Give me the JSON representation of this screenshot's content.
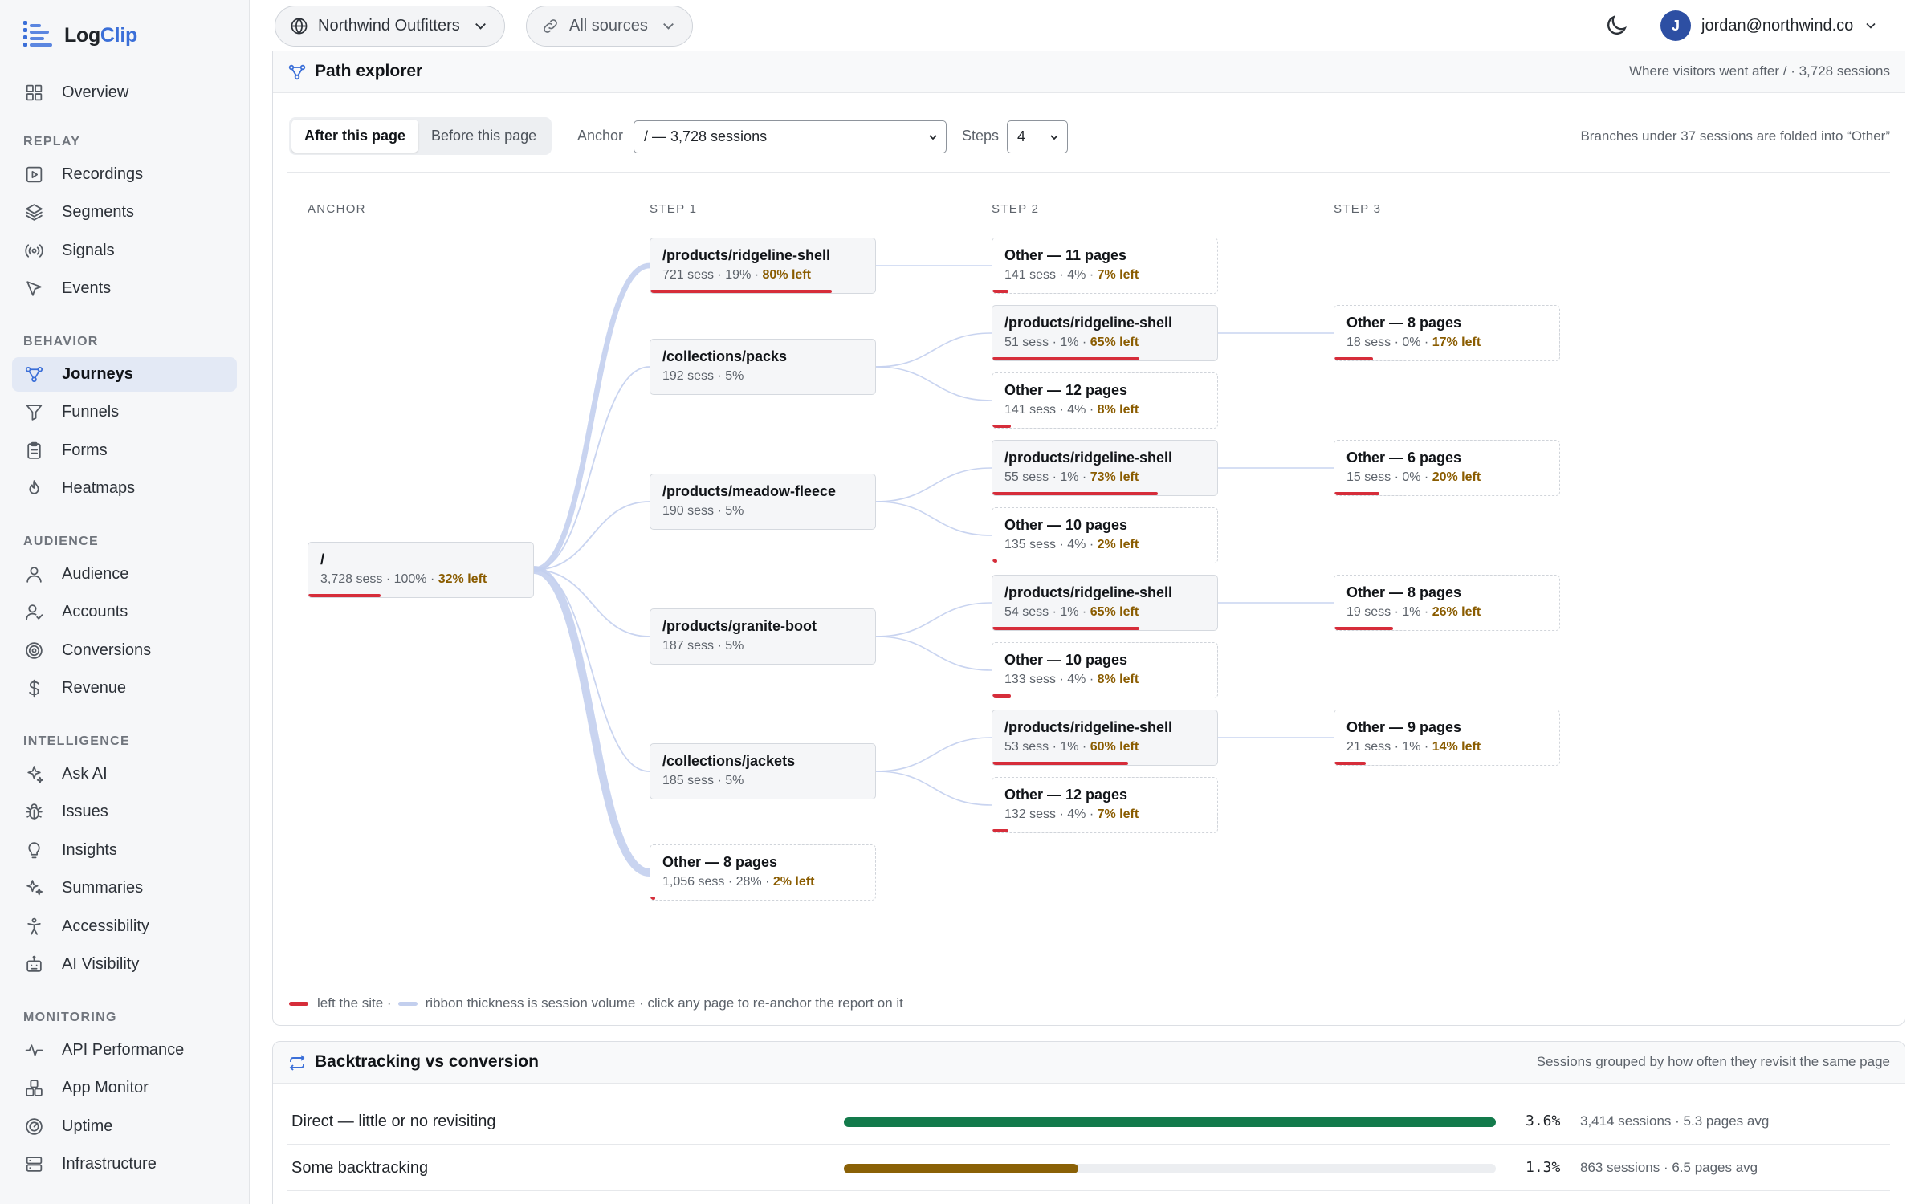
{
  "app": {
    "brand_a": "Log",
    "brand_b": "Clip"
  },
  "sidebar": {
    "top_item": {
      "label": "Overview",
      "icon": "grid-icon"
    },
    "groups": [
      {
        "label": "REPLAY",
        "items": [
          {
            "label": "Recordings",
            "icon": "play-icon"
          },
          {
            "label": "Segments",
            "icon": "layers-icon"
          },
          {
            "label": "Signals",
            "icon": "broadcast-icon"
          },
          {
            "label": "Events",
            "icon": "cursor-icon"
          }
        ]
      },
      {
        "label": "BEHAVIOR",
        "items": [
          {
            "label": "Journeys",
            "icon": "journey-icon",
            "active": true
          },
          {
            "label": "Funnels",
            "icon": "funnel-icon"
          },
          {
            "label": "Forms",
            "icon": "clipboard-icon"
          },
          {
            "label": "Heatmaps",
            "icon": "flame-icon"
          }
        ]
      },
      {
        "label": "AUDIENCE",
        "items": [
          {
            "label": "Audience",
            "icon": "user-icon"
          },
          {
            "label": "Accounts",
            "icon": "user-check-icon"
          },
          {
            "label": "Conversions",
            "icon": "target-icon"
          },
          {
            "label": "Revenue",
            "icon": "dollar-icon"
          }
        ]
      },
      {
        "label": "INTELLIGENCE",
        "items": [
          {
            "label": "Ask AI",
            "icon": "sparkle-icon"
          },
          {
            "label": "Issues",
            "icon": "bug-icon"
          },
          {
            "label": "Insights",
            "icon": "lightbulb-icon"
          },
          {
            "label": "Summaries",
            "icon": "sparkles-icon"
          },
          {
            "label": "Accessibility",
            "icon": "accessibility-icon"
          },
          {
            "label": "AI Visibility",
            "icon": "robot-icon"
          }
        ]
      },
      {
        "label": "MONITORING",
        "items": [
          {
            "label": "API Performance",
            "icon": "pulse-icon"
          },
          {
            "label": "App Monitor",
            "icon": "boxes-icon"
          },
          {
            "label": "Uptime",
            "icon": "gauge-icon"
          },
          {
            "label": "Infrastructure",
            "icon": "server-icon"
          }
        ]
      }
    ]
  },
  "topbar": {
    "workspace": "Northwind Outfitters",
    "sources": "All sources",
    "user_initial": "J",
    "user_email": "jordan@northwind.co"
  },
  "path_explorer": {
    "title": "Path explorer",
    "note": "Where visitors went after / · 3,728 sessions",
    "direction_tabs": [
      "After this page",
      "Before this page"
    ],
    "active_direction": 0,
    "anchor_label": "Anchor",
    "anchor_value": "/ — 3,728 sessions",
    "steps_label": "Steps",
    "steps_value": "4",
    "fold_note": "Branches under 37 sessions are folded into “Other”",
    "columns": [
      "ANCHOR",
      "STEP 1",
      "STEP 2",
      "STEP 3"
    ],
    "nodes": {
      "anchor": {
        "name": "/",
        "sessions": "3,728 sess",
        "share": "100%",
        "left": "32% left",
        "exit_fraction": 0.32
      },
      "s1": [
        {
          "name": "/products/ridgeline-shell",
          "sessions": "721 sess",
          "share": "19%",
          "left": "80% left",
          "exit_fraction": 0.8
        },
        {
          "name": "/collections/packs",
          "sessions": "192 sess",
          "share": "5%",
          "left": "",
          "exit_fraction": 0
        },
        {
          "name": "/products/meadow-fleece",
          "sessions": "190 sess",
          "share": "5%",
          "left": "",
          "exit_fraction": 0
        },
        {
          "name": "/products/granite-boot",
          "sessions": "187 sess",
          "share": "5%",
          "left": "",
          "exit_fraction": 0
        },
        {
          "name": "/collections/jackets",
          "sessions": "185 sess",
          "share": "5%",
          "left": "",
          "exit_fraction": 0
        },
        {
          "name": "Other — 8 pages",
          "sessions": "1,056 sess",
          "share": "28%",
          "left": "2% left",
          "exit_fraction": 0.02,
          "other": true
        }
      ],
      "s2": [
        {
          "name": "Other — 11 pages",
          "sessions": "141 sess",
          "share": "4%",
          "left": "7% left",
          "exit_fraction": 0.07,
          "other": true
        },
        {
          "name": "/products/ridgeline-shell",
          "sessions": "51 sess",
          "share": "1%",
          "left": "65% left",
          "exit_fraction": 0.65
        },
        {
          "name": "Other — 12 pages",
          "sessions": "141 sess",
          "share": "4%",
          "left": "8% left",
          "exit_fraction": 0.08,
          "other": true
        },
        {
          "name": "/products/ridgeline-shell",
          "sessions": "55 sess",
          "share": "1%",
          "left": "73% left",
          "exit_fraction": 0.73
        },
        {
          "name": "Other — 10 pages",
          "sessions": "135 sess",
          "share": "4%",
          "left": "2% left",
          "exit_fraction": 0.02,
          "other": true
        },
        {
          "name": "/products/ridgeline-shell",
          "sessions": "54 sess",
          "share": "1%",
          "left": "65% left",
          "exit_fraction": 0.65
        },
        {
          "name": "Other — 10 pages",
          "sessions": "133 sess",
          "share": "4%",
          "left": "8% left",
          "exit_fraction": 0.08,
          "other": true
        },
        {
          "name": "/products/ridgeline-shell",
          "sessions": "53 sess",
          "share": "1%",
          "left": "60% left",
          "exit_fraction": 0.6
        },
        {
          "name": "Other — 12 pages",
          "sessions": "132 sess",
          "share": "4%",
          "left": "7% left",
          "exit_fraction": 0.07,
          "other": true
        }
      ],
      "s3": [
        {
          "name": "Other — 8 pages",
          "sessions": "18 sess",
          "share": "0%",
          "left": "17% left",
          "exit_fraction": 0.17,
          "other": true
        },
        {
          "name": "Other — 6 pages",
          "sessions": "15 sess",
          "share": "0%",
          "left": "20% left",
          "exit_fraction": 0.2,
          "other": true
        },
        {
          "name": "Other — 8 pages",
          "sessions": "19 sess",
          "share": "1%",
          "left": "26% left",
          "exit_fraction": 0.26,
          "other": true
        },
        {
          "name": "Other — 9 pages",
          "sessions": "21 sess",
          "share": "1%",
          "left": "14% left",
          "exit_fraction": 0.14,
          "other": true
        }
      ]
    },
    "legend_exit": "left the site ·",
    "legend_ribbon": "ribbon thickness is session volume · click any page to re-anchor the report on it",
    "colors": {
      "exit": "#d62d3a",
      "ribbon": "#c3cfee",
      "left_text": "#8a5c00",
      "accent": "#3b6fd8"
    }
  },
  "backtracking": {
    "title": "Backtracking vs conversion",
    "note": "Sessions grouped by how often they revisit the same page",
    "rows": [
      {
        "label": "Direct — little or no revisiting",
        "fraction": 1.0,
        "color": "#137a4b",
        "pct": "3.6%",
        "detail": "3,414 sessions · 5.3 pages avg"
      },
      {
        "label": "Some backtracking",
        "fraction": 0.36,
        "color": "#8a6106",
        "pct": "1.3%",
        "detail": "863 sessions · 6.5 pages avg"
      }
    ]
  }
}
